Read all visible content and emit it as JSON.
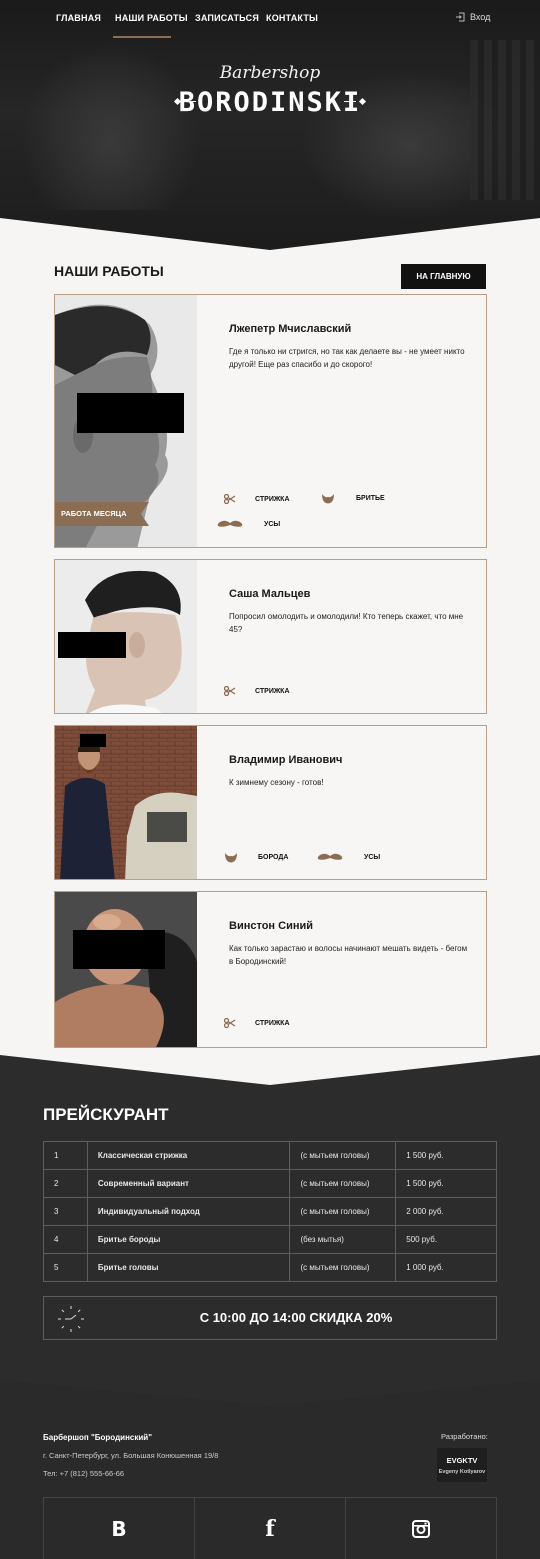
{
  "nav": {
    "items": [
      {
        "label": "ГЛАВНАЯ"
      },
      {
        "label": "НАШИ РАБОТЫ"
      },
      {
        "label": "ЗАПИСАТЬСЯ"
      },
      {
        "label": "КОНТАКТЫ"
      }
    ],
    "active_index": 1,
    "login_label": "Вход",
    "login_icon": "login-icon"
  },
  "logo": {
    "script": "Barbershop",
    "main": "BORODINSKI"
  },
  "works": {
    "title": "НАШИ РАБОТЫ",
    "home_button": "НА ГЛАВНУЮ",
    "badge": "РАБОТА МЕСЯЦА",
    "cards": [
      {
        "name": "Лжепетр Мчиславский",
        "text": "Где я только ни стригся, но так как делаете вы - не умеет никто другой! Еще раз спасибо и до скорого!",
        "services": [
          {
            "icon": "scissors-icon",
            "label": "СТРИЖКА"
          },
          {
            "icon": "beard-icon",
            "label": "БРИТЬЕ"
          },
          {
            "icon": "mustache-icon",
            "label": "УСЫ"
          }
        ]
      },
      {
        "name": "Саша Мальцев",
        "text": "Попросил омолодить и омолодили! Кто теперь скажет, что мне 45?",
        "services": [
          {
            "icon": "scissors-icon",
            "label": "СТРИЖКА"
          }
        ]
      },
      {
        "name": "Владимир Иванович",
        "text": "К зимнему сезону - готов!",
        "services": [
          {
            "icon": "beard-icon",
            "label": "БОРОДА"
          },
          {
            "icon": "mustache-icon",
            "label": "УСЫ"
          }
        ]
      },
      {
        "name": "Винстон Синий",
        "text": "Как только зарастаю и волосы начинают мешать видеть - бегом в Бородинский!",
        "services": [
          {
            "icon": "scissors-icon",
            "label": "СТРИЖКА"
          }
        ]
      }
    ]
  },
  "price": {
    "title": "ПРЕЙСКУРАНТ",
    "rows": [
      {
        "num": "1",
        "name": "Классическая стрижка",
        "note": "(с мытьем головы)",
        "price": "1 500 руб."
      },
      {
        "num": "2",
        "name": "Современный вариант",
        "note": "(с мытьем головы)",
        "price": "1 500 руб."
      },
      {
        "num": "3",
        "name": "Индивидуальный подход",
        "note": "(с мытьем головы)",
        "price": "2 000 руб."
      },
      {
        "num": "4",
        "name": "Бритье бороды",
        "note": "(без мытья)",
        "price": "500 руб."
      },
      {
        "num": "5",
        "name": "Бритье головы",
        "note": "(с мытьем головы)",
        "price": "1 000 руб."
      }
    ],
    "discount": "С 10:00 ДО 14:00 СКИДКА 20%"
  },
  "footer": {
    "company": "Барбершоп \"Бородинский\"",
    "address": "г. Санкт-Петербург, ул. Большая Конюшенная 19/8",
    "phone": "Тел: +7 (812) 555-66-66",
    "developed_label": "Разработано:",
    "dev_name": "EVGKTV",
    "dev_sub": "Evgeny Kotlyarov",
    "socials": [
      {
        "icon": "vk-icon",
        "label": "B"
      },
      {
        "icon": "facebook-icon",
        "label": "f"
      },
      {
        "icon": "instagram-icon",
        "label": ""
      }
    ]
  },
  "colors": {
    "accent": "#8a6d52",
    "dark": "#2c2c2c",
    "light_bg": "#f6f5f3"
  }
}
